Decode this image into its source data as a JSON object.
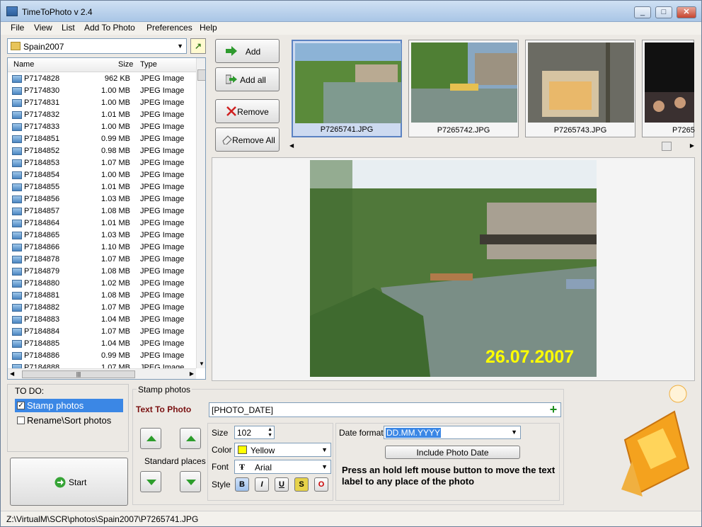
{
  "window": {
    "title": "TimeToPhoto v 2.4"
  },
  "menu": [
    "File",
    "View",
    "List",
    "Add To Photo",
    "Preferences",
    "Help"
  ],
  "folder": {
    "selected": "Spain2007"
  },
  "filelist": {
    "columns": [
      "Name",
      "Size",
      "Type"
    ],
    "rows": [
      [
        "P7174828",
        "962 KB",
        "JPEG Image"
      ],
      [
        "P7174830",
        "1.00 MB",
        "JPEG Image"
      ],
      [
        "P7174831",
        "1.00 MB",
        "JPEG Image"
      ],
      [
        "P7174832",
        "1.01 MB",
        "JPEG Image"
      ],
      [
        "P7174833",
        "1.00 MB",
        "JPEG Image"
      ],
      [
        "P7184851",
        "0.99 MB",
        "JPEG Image"
      ],
      [
        "P7184852",
        "0.98 MB",
        "JPEG Image"
      ],
      [
        "P7184853",
        "1.07 MB",
        "JPEG Image"
      ],
      [
        "P7184854",
        "1.00 MB",
        "JPEG Image"
      ],
      [
        "P7184855",
        "1.01 MB",
        "JPEG Image"
      ],
      [
        "P7184856",
        "1.03 MB",
        "JPEG Image"
      ],
      [
        "P7184857",
        "1.08 MB",
        "JPEG Image"
      ],
      [
        "P7184864",
        "1.01 MB",
        "JPEG Image"
      ],
      [
        "P7184865",
        "1.03 MB",
        "JPEG Image"
      ],
      [
        "P7184866",
        "1.10 MB",
        "JPEG Image"
      ],
      [
        "P7184878",
        "1.07 MB",
        "JPEG Image"
      ],
      [
        "P7184879",
        "1.08 MB",
        "JPEG Image"
      ],
      [
        "P7184880",
        "1.02 MB",
        "JPEG Image"
      ],
      [
        "P7184881",
        "1.08 MB",
        "JPEG Image"
      ],
      [
        "P7184882",
        "1.07 MB",
        "JPEG Image"
      ],
      [
        "P7184883",
        "1.04 MB",
        "JPEG Image"
      ],
      [
        "P7184884",
        "1.07 MB",
        "JPEG Image"
      ],
      [
        "P7184885",
        "1.04 MB",
        "JPEG Image"
      ],
      [
        "P7184886",
        "0.99 MB",
        "JPEG Image"
      ],
      [
        "P7184888",
        "1.07 MB",
        "JPEG Image"
      ]
    ]
  },
  "buttons": {
    "add": "Add",
    "add_all": "Add all",
    "remove": "Remove",
    "remove_all": "Remove All"
  },
  "thumbnails": [
    "P7265741.JPG",
    "P7265742.JPG",
    "P7265743.JPG",
    "P7265"
  ],
  "preview": {
    "date_stamp": "26.07.2007"
  },
  "todo": {
    "title": "TO DO:",
    "items": [
      {
        "label": "Stamp photos",
        "checked": true
      },
      {
        "label": "Rename\\Sort photos",
        "checked": false
      }
    ]
  },
  "start": {
    "label": "Start"
  },
  "stamp": {
    "title": "Stamp photos",
    "text_label": "Text To Photo",
    "text_value": "[PHOTO_DATE]",
    "standard_places": "Standard places",
    "size_label": "Size",
    "size_value": "102",
    "color_label": "Color",
    "color_value": "Yellow",
    "color_hex": "#ffff00",
    "font_label": "Font",
    "font_value": "Arial",
    "style_label": "Style",
    "styles": [
      "B",
      "I",
      "U",
      "S",
      "O"
    ],
    "date_format_label": "Date format",
    "date_format_value": "DD.MM.YYYY",
    "include_date_button": "Include Photo Date",
    "hint": "Press an hold left mouse button to move the text label to any place of the photo"
  },
  "status": {
    "path": "Z:\\VirtualM\\SCR\\photos\\Spain2007\\P7265741.JPG"
  }
}
